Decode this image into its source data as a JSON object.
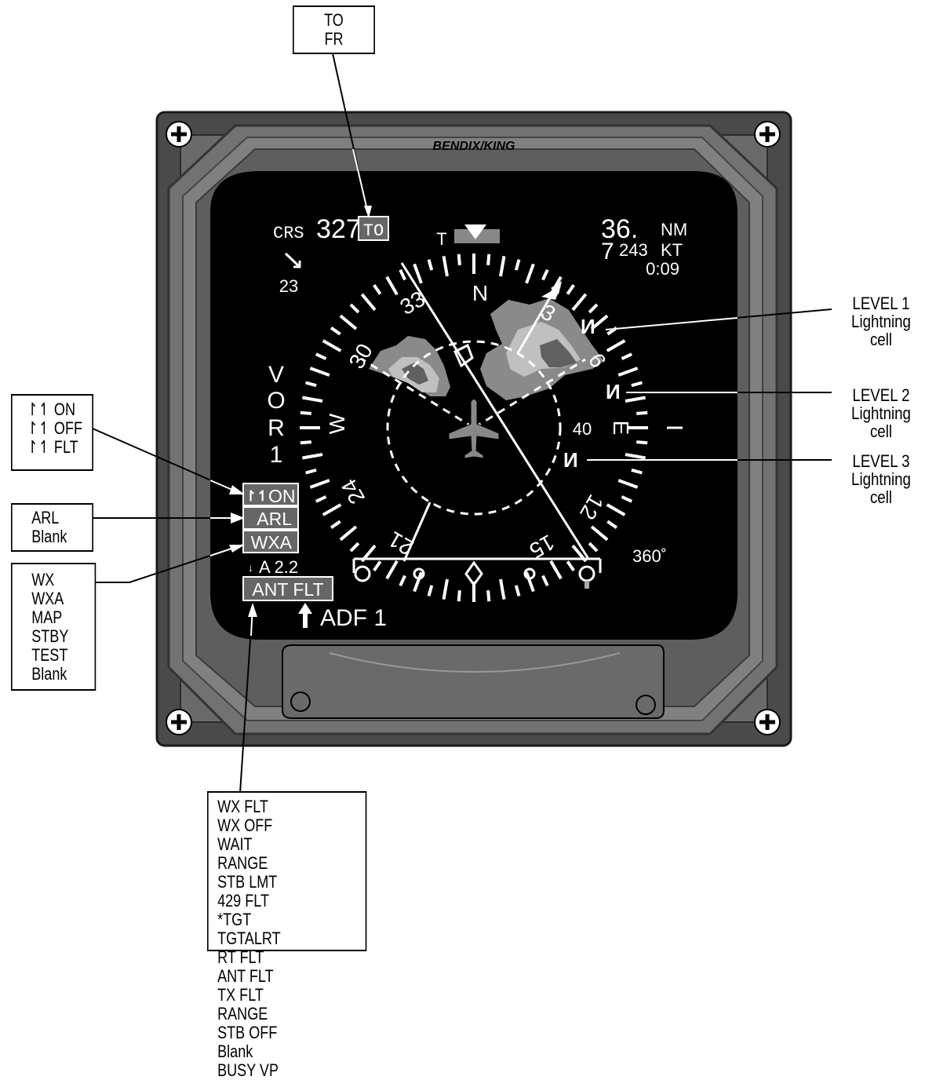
{
  "brand": "BENDIX/KING",
  "callouts": {
    "to_fr": [
      "TO",
      "FR"
    ],
    "lightning_modes": [
      "ON",
      "OFF",
      "FLT"
    ],
    "arl": [
      "ARL",
      "Blank"
    ],
    "wx_modes": [
      "WX",
      "WXA",
      "MAP",
      "STBY",
      "TEST",
      "Blank"
    ],
    "faults_left": [
      "WX FLT",
      "WX OFF",
      "WAIT",
      "RANGE",
      "STB LMT",
      "429 FLT",
      "*TGT",
      "TGTALRT"
    ],
    "faults_right": [
      "RT FLT",
      "ANT FLT",
      "TX FLT",
      "RANGE",
      "STB OFF",
      "Blank",
      "BUSY VP"
    ]
  },
  "lightning_labels": [
    {
      "line1": "LEVEL 1",
      "line2": "Lightning",
      "line3": "cell"
    },
    {
      "line1": "LEVEL 2",
      "line2": "Lightning",
      "line3": "cell"
    },
    {
      "line1": "LEVEL 3",
      "line2": "Lightning",
      "line3": "cell"
    }
  ],
  "display": {
    "crs_label": "CRS",
    "crs_value": "327",
    "to_flag": "TO",
    "bearing_value": "23",
    "distance": "36.",
    "distance_decimal": "7",
    "distance_unit": "NM",
    "speed": "243",
    "speed_unit": "KT",
    "time": "0:09",
    "nav_source": [
      "V",
      "O",
      "R",
      "1"
    ],
    "heading_top": "N",
    "heading_33": "33",
    "heading_30": "30",
    "heading_3": "3",
    "heading_6": "6",
    "heading_W": "W",
    "heading_E": "E",
    "heading_24": "24",
    "heading_12": "12",
    "heading_21": "21",
    "heading_15": "15",
    "true_marker": "T",
    "range_ring_label": "40",
    "sector_label": "360˚",
    "lightning_status": "ON",
    "arl_box": "ARL",
    "wxa_box": "WXA",
    "antenna_tilt": "A  2.2",
    "fault_box": "ANT FLT",
    "bearing_source": "ADF  1"
  }
}
